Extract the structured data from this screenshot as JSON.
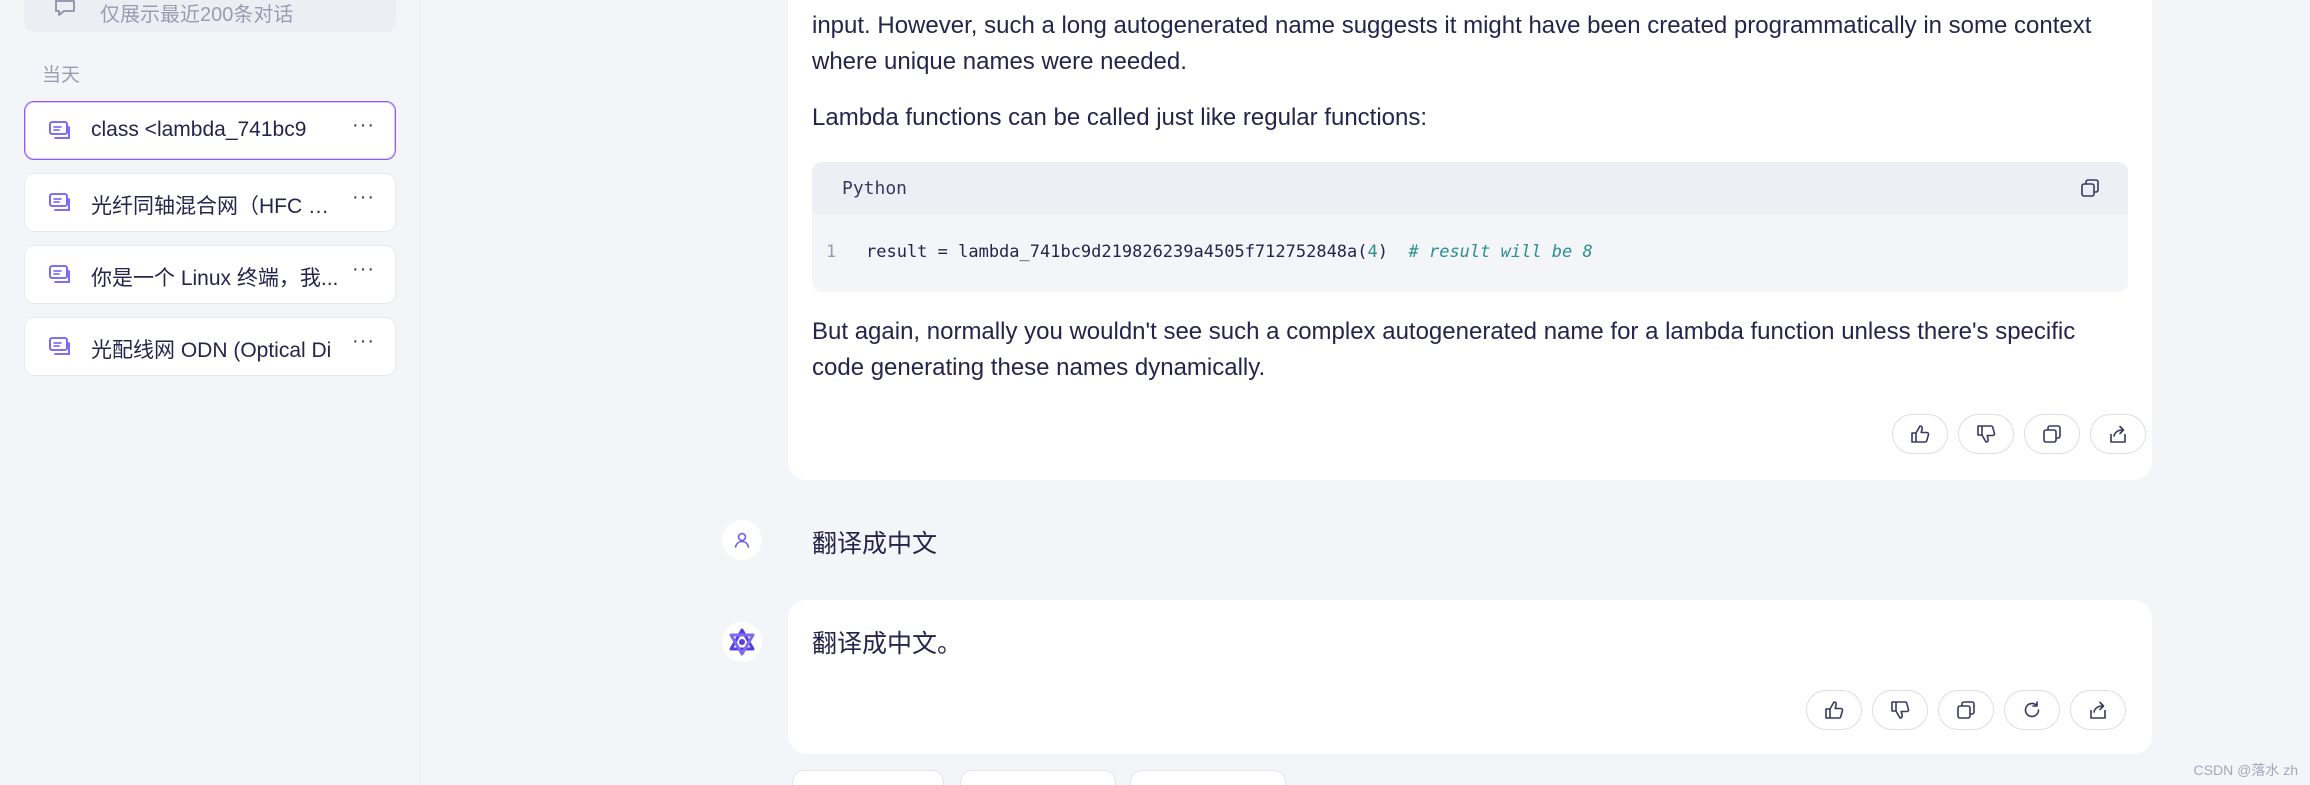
{
  "sidebar": {
    "notice": "仅展示最近200条对话",
    "section": "当天",
    "conversations": [
      {
        "label": "class <lambda_741bc9",
        "more": "···"
      },
      {
        "label": "光纤同轴混合网（HFC 网）",
        "more": "···"
      },
      {
        "label": "你是一个 Linux 终端，我...",
        "more": "···"
      },
      {
        "label": "光配线网 ODN (Optical Di",
        "more": "···"
      }
    ]
  },
  "chat": {
    "answer1": {
      "para1": "input. However, such a long autogenerated name suggests it might have been created programmatically in some context where unique names were needed.",
      "para2": "Lambda functions can be called just like regular functions:",
      "code": {
        "language": "Python",
        "line_number": "1",
        "code_text": "result = lambda_741bc9d219826239a4505f712752848a(",
        "code_arg": "4",
        "code_close": ")",
        "comment": "# result will be 8"
      },
      "para3": "But again, normally you wouldn't see such a complex autogenerated name for a lambda function unless there's specific code generating these names dynamically."
    },
    "user_message": "翻译成中文",
    "answer2": {
      "text": "翻译成中文。"
    }
  },
  "colors": {
    "accent": "#6b5cf0",
    "background": "#f4f5f9",
    "bubble": "#ffffff",
    "active_border": "#8a5cf0"
  },
  "icons": {
    "like": "thumbs-up-icon",
    "dislike": "thumbs-down-icon",
    "copy": "copy-icon",
    "regenerate": "refresh-icon",
    "share": "share-icon"
  },
  "watermark": "CSDN @落水 zh"
}
